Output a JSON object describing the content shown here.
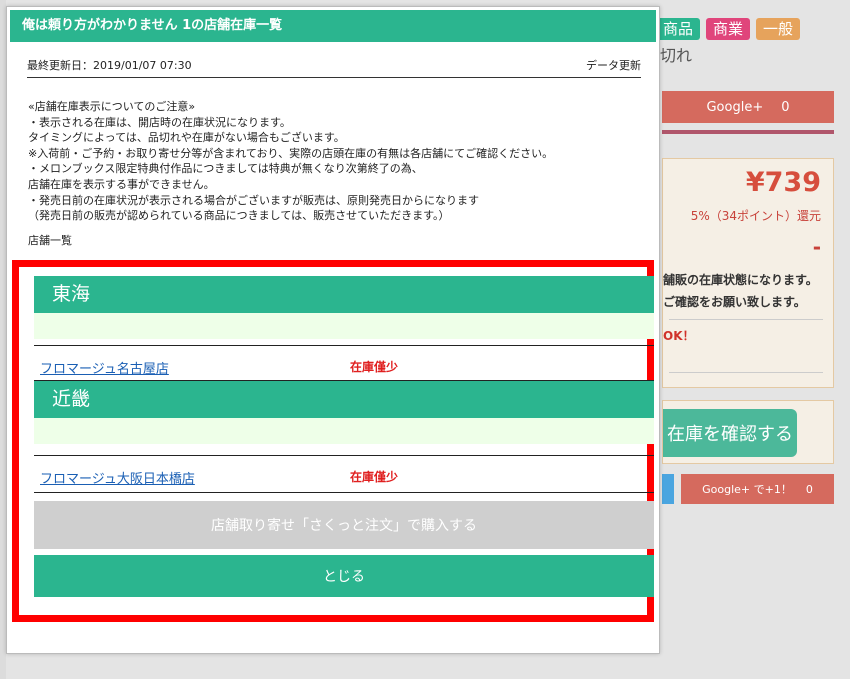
{
  "background": {
    "tags": [
      "商品",
      "商業",
      "一般"
    ],
    "stock_text": "切れ",
    "google_plus": {
      "label": "Google+",
      "count": "0"
    },
    "price": "¥739",
    "points": "5%（34ポイント）還元",
    "dash": "-",
    "stock_notice_1": "舗販の在庫状態になります。",
    "stock_notice_2": "ご確認をお願い致します。",
    "ok_text": "OK！",
    "check_stock_button": "在庫を確認する",
    "google_plus_small": {
      "label": "Google+ で+1！",
      "count": "0"
    }
  },
  "modal": {
    "title": "俺は頼り方がわかりません 1の店舗在庫一覧",
    "last_updated": "最終更新日：2019/01/07 07:30",
    "refresh_label": "データ更新",
    "notice_lines": [
      "«店舗在庫表示についてのご注意»",
      "・表示される在庫は、開店時の在庫状況になります。",
      "タイミングによっては、品切れや在庫がない場合もございます。",
      "※入荷前・ご予約・お取り寄せ分等が含まれており、実際の店頭在庫の有無は各店舗にてご確認ください。",
      "・メロンブックス限定特典付作品につきましては特典が無くなり次第終了の為、",
      "店舗在庫を表示する事ができません。",
      "・発売日前の在庫状況が表示される場合がございますが販売は、原則発売日からになります",
      "（発売日前の販売が認められている商品につきましては、販売させていただきます。）"
    ],
    "store_list_label": "店舗一覧",
    "regions": [
      {
        "name": "東海",
        "stores": [
          {
            "name": "フロマージュ名古屋店",
            "status": "在庫僅少"
          }
        ]
      },
      {
        "name": "近畿",
        "stores": [
          {
            "name": "フロマージュ大阪日本橋店",
            "status": "在庫僅少"
          }
        ]
      }
    ],
    "order_button": "店舗取り寄せ「さくっと注文」で購入する",
    "close_button": "とじる"
  }
}
